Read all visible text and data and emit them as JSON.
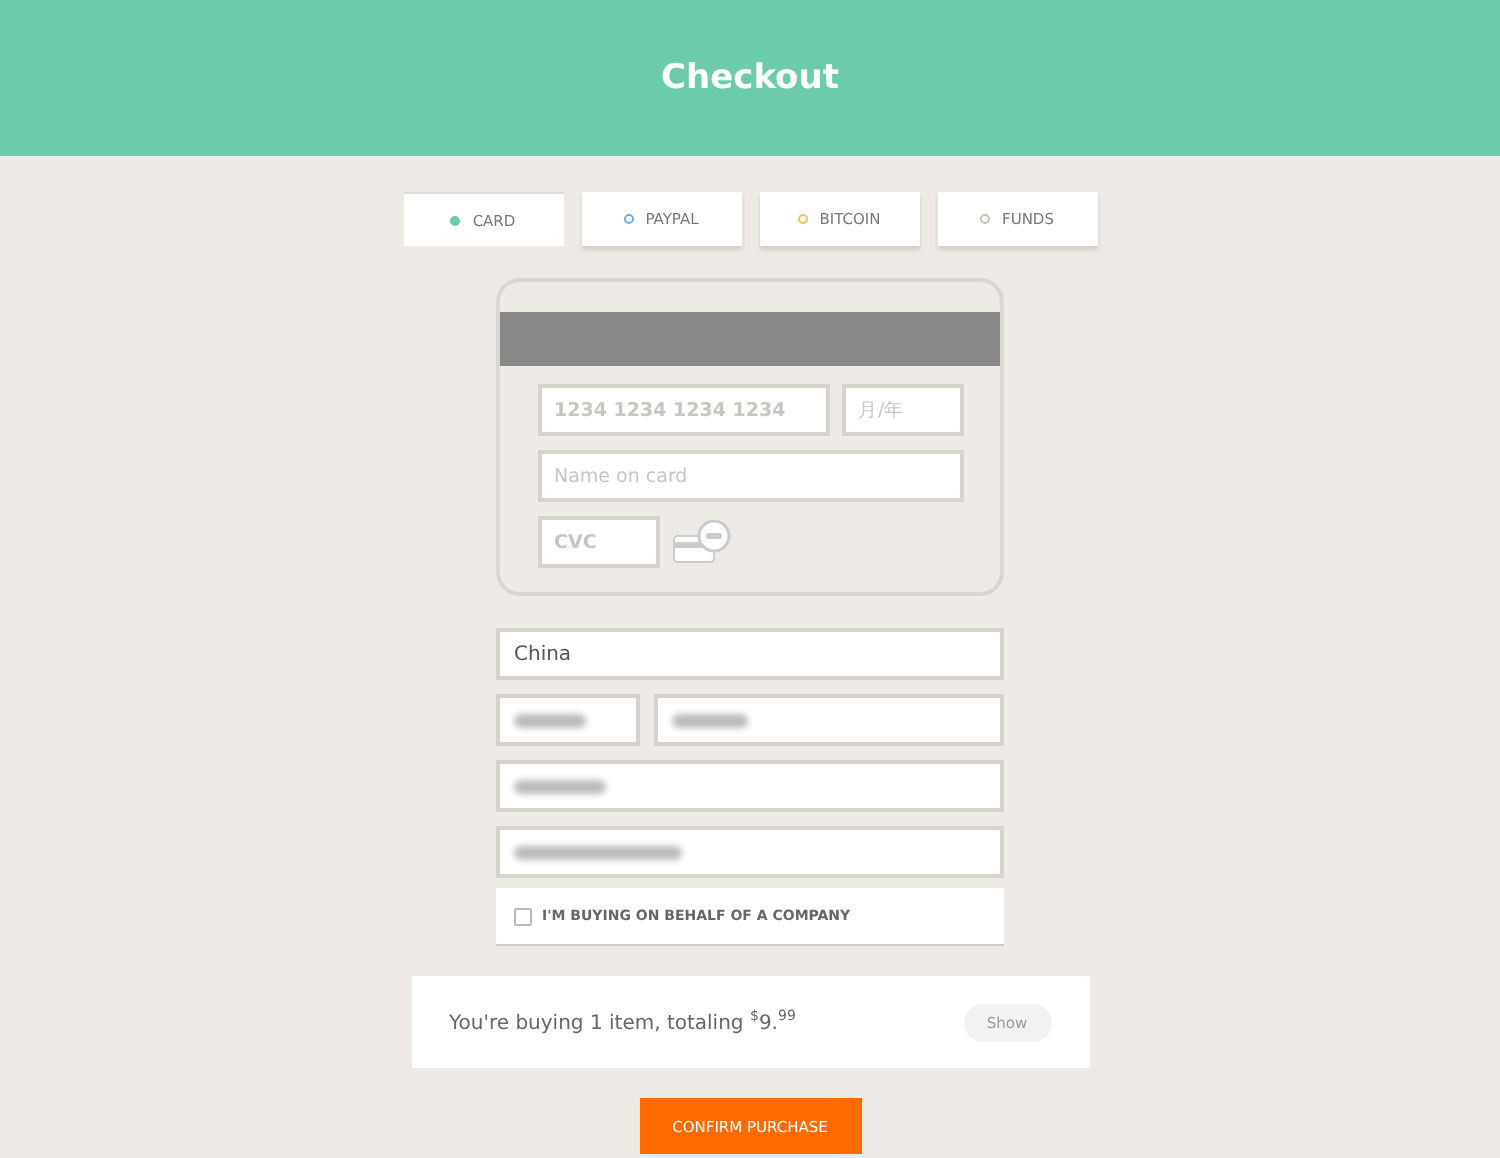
{
  "header": {
    "title": "Checkout"
  },
  "tabs": [
    {
      "label": "CARD",
      "selected": true,
      "color": "#6ccbab"
    },
    {
      "label": "PAYPAL",
      "selected": false,
      "color": "#6aaee0"
    },
    {
      "label": "BITCOIN",
      "selected": false,
      "color": "#f5c15a"
    },
    {
      "label": "FUNDS",
      "selected": false,
      "color": "#c9bfb5"
    }
  ],
  "card": {
    "number": {
      "placeholder": "1234 1234 1234 1234"
    },
    "expiry": {
      "placeholder": "月/年"
    },
    "name": {
      "placeholder": "Name on card"
    },
    "cvc": {
      "placeholder": "CVC"
    }
  },
  "address": {
    "country": {
      "value": "China"
    }
  },
  "company_checkbox": {
    "label": "I'M BUYING ON BEHALF OF A COMPANY",
    "checked": false
  },
  "summary": {
    "text": "You're buying 1 item, totaling",
    "currency": "$",
    "amount": "9.",
    "cents": "99",
    "button": "Show"
  },
  "confirm_button": "CONFIRM PURCHASE"
}
